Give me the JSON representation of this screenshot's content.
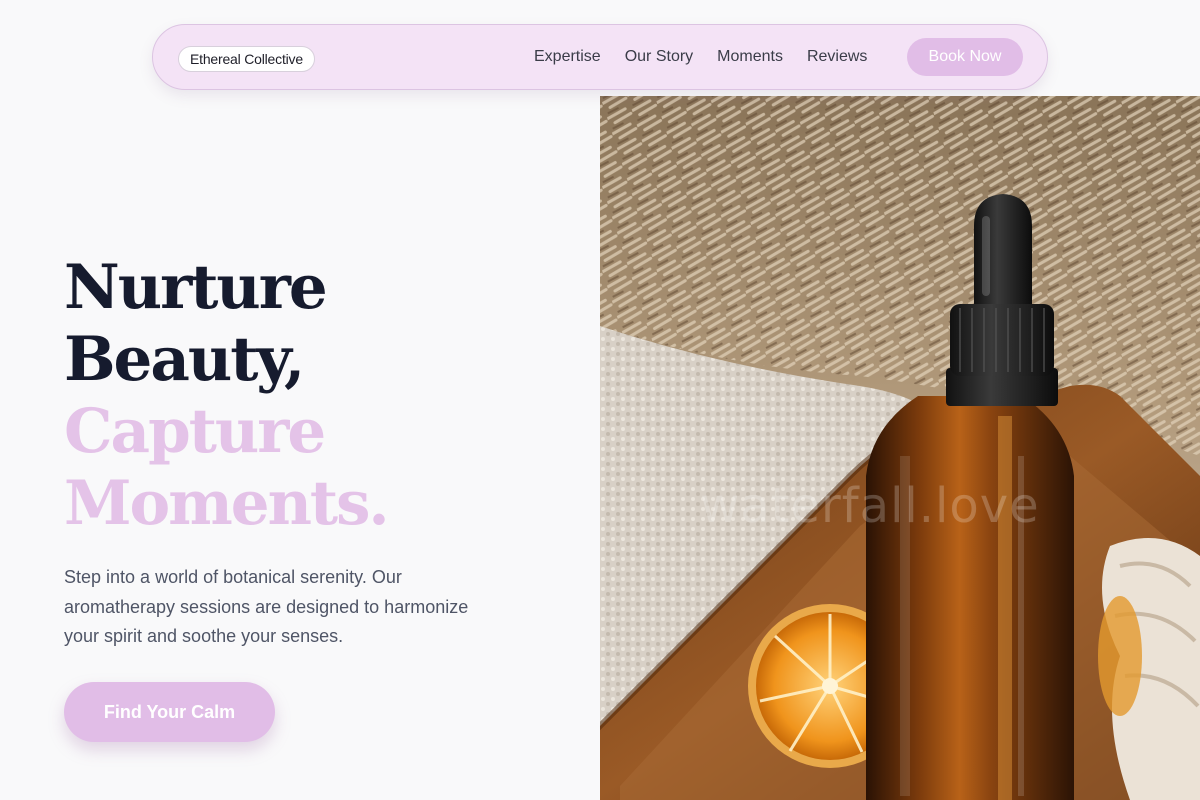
{
  "brand": {
    "name": "Ethereal Collective"
  },
  "nav": {
    "links": [
      "Expertise",
      "Our Story",
      "Moments",
      "Reviews"
    ],
    "cta_label": "Book Now"
  },
  "hero": {
    "headline_dark": [
      "Nurture",
      "Beauty,"
    ],
    "headline_accent": [
      "Capture",
      "Moments."
    ],
    "subtext_lines": [
      "Step into a world of botanical serenity. Our",
      "aromatherapy sessions are designed to harmonize",
      "your spirit and soothe your senses."
    ],
    "cta_label": "Find Your Calm",
    "image": {
      "watermark": "waterfall.love"
    }
  },
  "colors": {
    "background": "#f9f9fa",
    "nav_background": "#f4e3f6",
    "accent": "#e1bde7",
    "headline_dark": "#161b2e",
    "headline_accent": "#e4c3e8",
    "body_text": "#4f5566"
  }
}
